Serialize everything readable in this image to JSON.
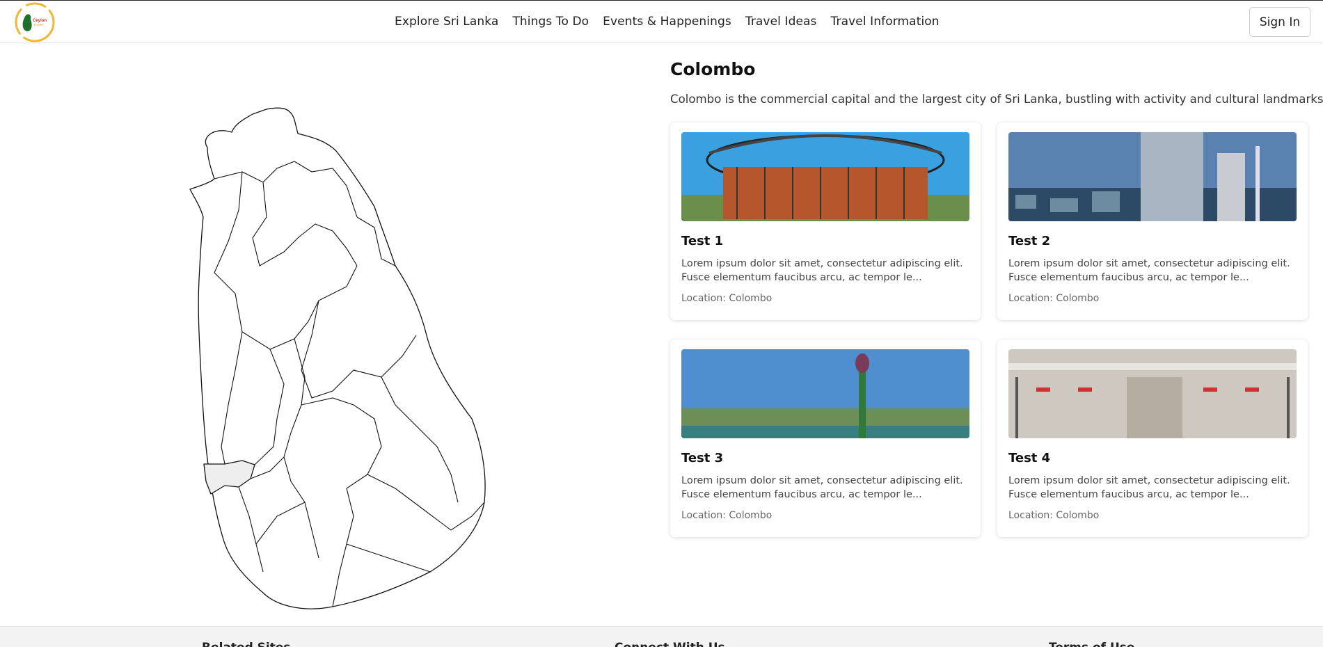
{
  "header": {
    "logo_text_1": "Ceylon",
    "logo_text_2": "Travels",
    "nav": [
      "Explore Sri Lanka",
      "Things To Do",
      "Events & Happenings",
      "Travel Ideas",
      "Travel Information"
    ],
    "sign_in": "Sign In"
  },
  "map": {
    "highlighted_district": "Colombo",
    "highlight_color": "#eeeeee",
    "stroke_color": "#111111"
  },
  "main": {
    "title": "Colombo",
    "description": "Colombo is the commercial capital and the largest city of Sri Lanka, bustling with activity and cultural landmarks."
  },
  "cards": [
    {
      "title": "Test 1",
      "desc": "Lorem ipsum dolor sit amet, consectetur adipiscing elit. Fusce elementum faucibus arcu, ac tempor le...",
      "location": "Location: Colombo",
      "image": "lotus-tower-dome"
    },
    {
      "title": "Test 2",
      "desc": "Lorem ipsum dolor sit amet, consectetur adipiscing elit. Fusce elementum faucibus arcu, ac tempor le...",
      "location": "Location: Colombo",
      "image": "city-skyline"
    },
    {
      "title": "Test 3",
      "desc": "Lorem ipsum dolor sit amet, consectetur adipiscing elit. Fusce elementum faucibus arcu, ac tempor le...",
      "location": "Location: Colombo",
      "image": "lotus-tower-city"
    },
    {
      "title": "Test 4",
      "desc": "Lorem ipsum dolor sit amet, consectetur adipiscing elit. Fusce elementum faucibus arcu, ac tempor le...",
      "location": "Location: Colombo",
      "image": "shopping-mall"
    }
  ],
  "footer": {
    "col1": "Related Sites",
    "col2": "Connect With Us",
    "col3": "Terms of Use"
  }
}
